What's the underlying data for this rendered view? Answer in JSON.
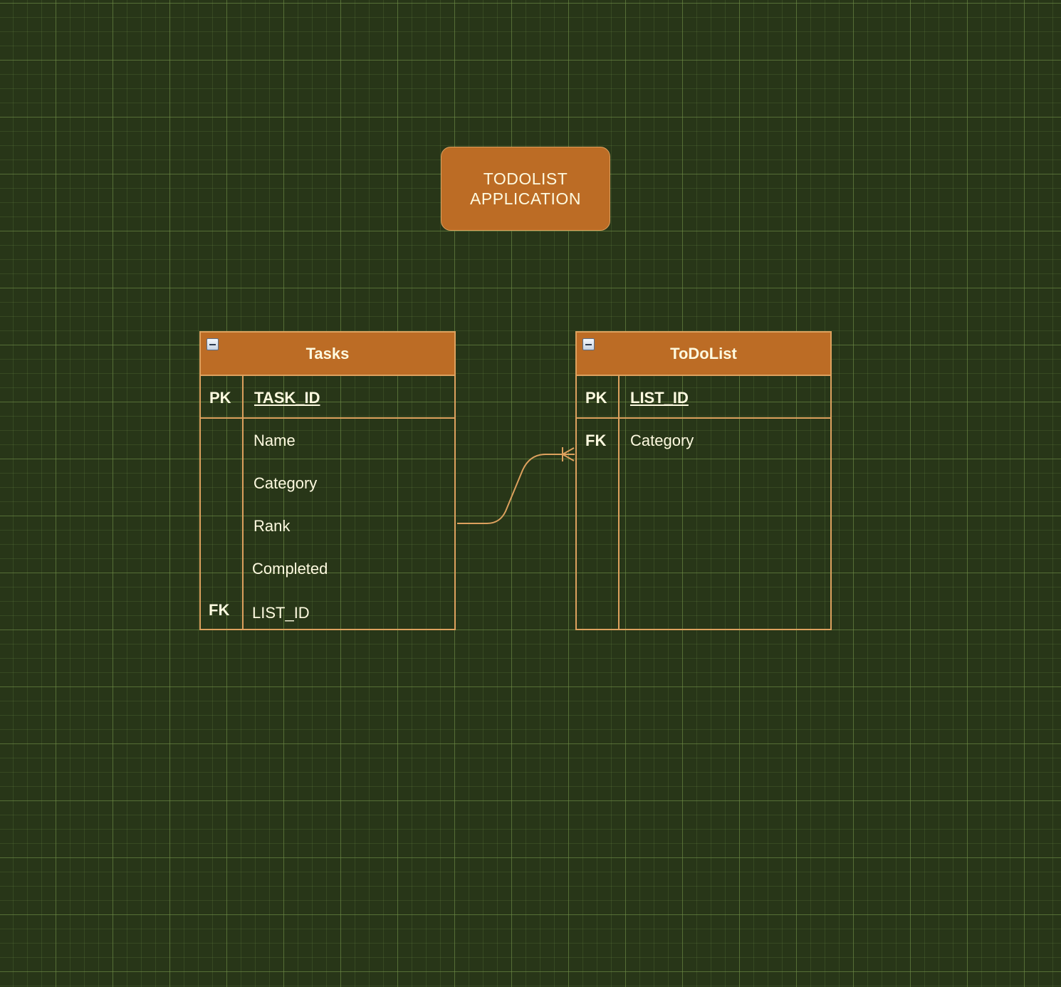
{
  "title_box": {
    "text": "TODOLIST\nAPPLICATION"
  },
  "tables": {
    "tasks": {
      "name": "Tasks",
      "primary_key": {
        "key": "PK",
        "field": "TASK_ID"
      },
      "rows": [
        {
          "key": "",
          "field": "Name"
        },
        {
          "key": "",
          "field": "Category"
        },
        {
          "key": "",
          "field": "Rank"
        },
        {
          "key": "",
          "field": "Completed"
        },
        {
          "key": "FK",
          "field": "LIST_ID"
        }
      ]
    },
    "todolist": {
      "name": "ToDoList",
      "primary_key": {
        "key": "PK",
        "field": "LIST_ID"
      },
      "rows": [
        {
          "key": "FK",
          "field": "Category"
        }
      ]
    }
  },
  "relationship": {
    "from": "Tasks.Rank",
    "to": "ToDoList",
    "target_end": "crows-foot-many"
  },
  "colors": {
    "background": "#283618",
    "grid": "#6e8c46",
    "entity_fill": "#bc6c25",
    "stroke": "#dda15e",
    "text": "#fefae0"
  }
}
